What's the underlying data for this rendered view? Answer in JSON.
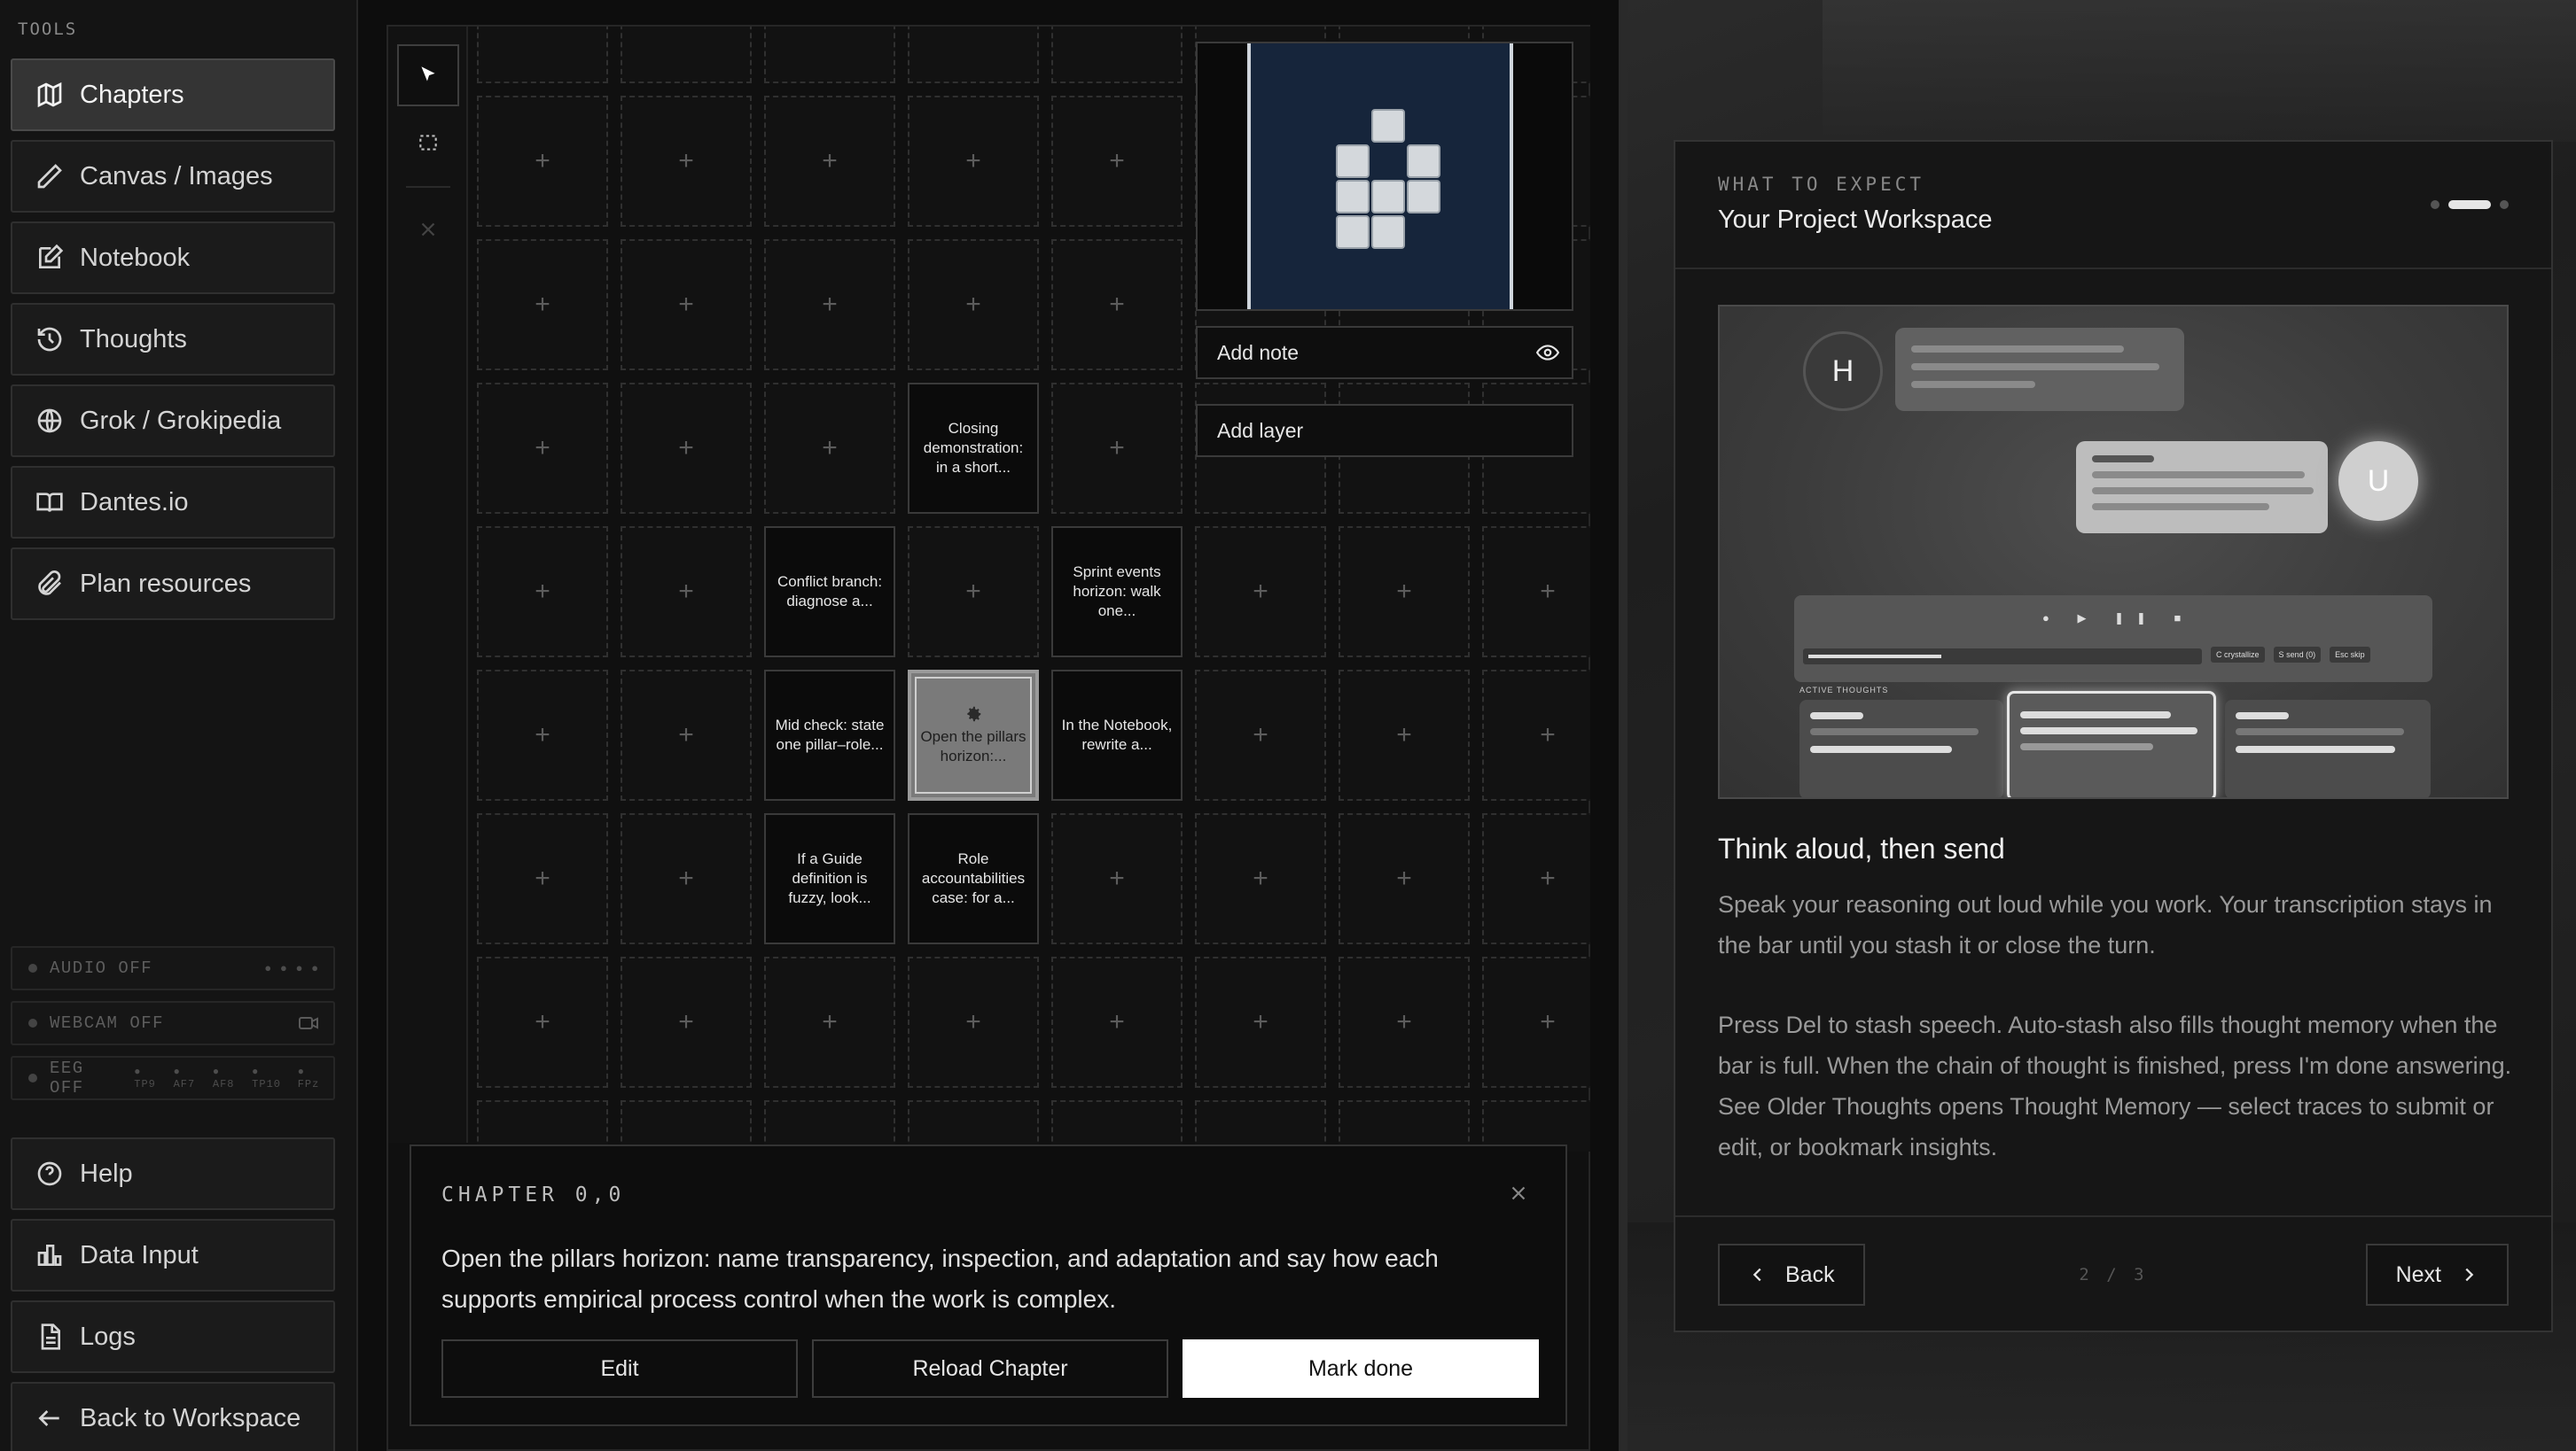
{
  "sidebar": {
    "tools_label": "TOOLS",
    "items": [
      {
        "label": "Chapters",
        "icon": "map-icon",
        "active": true
      },
      {
        "label": "Canvas / Images",
        "icon": "pencil-icon"
      },
      {
        "label": "Notebook",
        "icon": "edit-icon"
      },
      {
        "label": "Thoughts",
        "icon": "history-icon"
      },
      {
        "label": "Grok / Grokipedia",
        "icon": "globe-icon"
      },
      {
        "label": "Dantes.io",
        "icon": "book-icon"
      },
      {
        "label": "Plan resources",
        "icon": "paperclip-icon"
      }
    ],
    "status": {
      "audio": "AUDIO OFF",
      "webcam": "WEBCAM OFF",
      "eeg": "EEG OFF",
      "eeg_channels": [
        "TP9",
        "AF7",
        "AF8",
        "TP10",
        "FPz"
      ]
    },
    "bottom_items": [
      {
        "label": "Help",
        "icon": "help-circle-icon"
      },
      {
        "label": "Data Input",
        "icon": "bar-chart-icon"
      },
      {
        "label": "Logs",
        "icon": "file-icon"
      },
      {
        "label": "Back to Workspace",
        "icon": "arrow-left-icon"
      }
    ]
  },
  "canvas": {
    "cells": [
      {
        "col": 3,
        "row": 3,
        "text": "Closing demonstration: in a short..."
      },
      {
        "col": 2,
        "row": 4,
        "text": "Conflict branch: diagnose a..."
      },
      {
        "col": 4,
        "row": 4,
        "text": "Sprint events horizon: walk one..."
      },
      {
        "col": 2,
        "row": 5,
        "text": "Mid check: state one pillar–role..."
      },
      {
        "col": 3,
        "row": 5,
        "text": "Open the pillars horizon:...",
        "selected": true
      },
      {
        "col": 4,
        "row": 5,
        "text": "In the Notebook, rewrite a..."
      },
      {
        "col": 2,
        "row": 6,
        "text": "If a Guide definition is fuzzy, look..."
      },
      {
        "col": 3,
        "row": 6,
        "text": "Role accountabilities case: for a..."
      }
    ],
    "add_note": "Add note",
    "add_layer": "Add layer",
    "plus_glyph": "+"
  },
  "chapter": {
    "title": "CHAPTER 0,0",
    "text": "Open the pillars horizon: name transparency, inspection, and adaptation and say how each supports empirical process control when the work is complex.",
    "edit": "Edit",
    "reload": "Reload Chapter",
    "done": "Mark done"
  },
  "onboarding": {
    "kicker": "WHAT TO EXPECT",
    "title": "Your Project Workspace",
    "heading": "Think aloud, then send",
    "body1": "Speak your reasoning out loud while you work. Your transcription stays in the bar until you stash it or close the turn.",
    "body2": "Press Del to stash speech. Auto-stash also fills thought memory when the bar is full. When the chain of thought is finished, press I'm done answering. See Older Thoughts opens Thought Memory — select traces to submit or edit, or bookmark insights.",
    "back": "Back",
    "next": "Next",
    "page": "2 / 3",
    "illustration": {
      "user_initial": "U",
      "helper_initial": "H",
      "active_thoughts": "ACTIVE THOUGHTS",
      "keys": [
        {
          "key": "C",
          "label": "crystallize"
        },
        {
          "key": "S",
          "label": "send (0)"
        },
        {
          "key": "Esc",
          "label": "skip"
        }
      ]
    }
  },
  "colors": {
    "accent": "#ffffff",
    "preview_bg": "#16253b",
    "selected_cell": "#7a7a7a"
  }
}
